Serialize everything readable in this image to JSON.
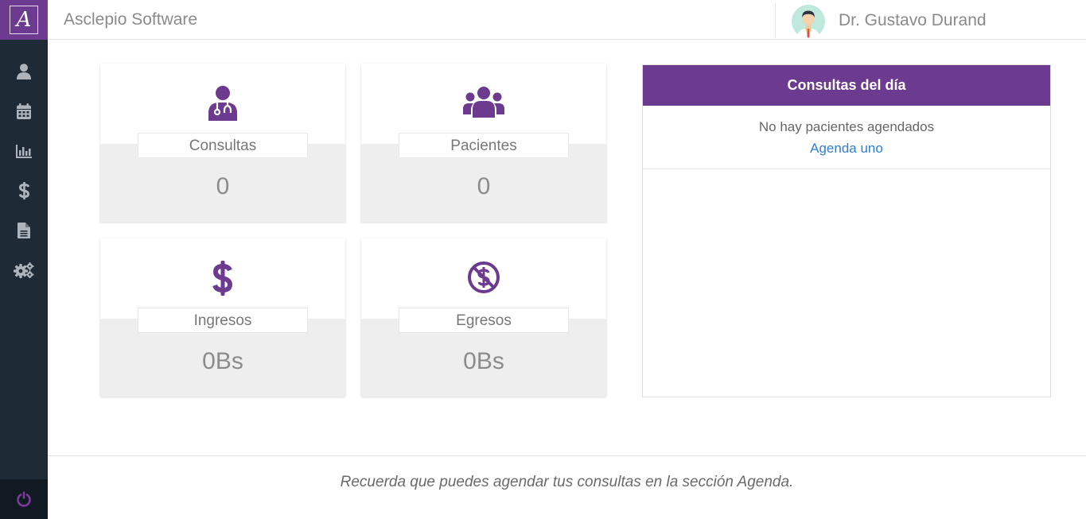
{
  "brand": {
    "logo_letter": "A",
    "app_title": "Asclepio Software",
    "accent": "#6c3a8e"
  },
  "user": {
    "name": "Dr. Gustavo Durand",
    "avatar_icon": "doctor-avatar-icon"
  },
  "sidebar": {
    "items": [
      {
        "icon": "user-icon"
      },
      {
        "icon": "calendar-icon"
      },
      {
        "icon": "bar-chart-icon"
      },
      {
        "icon": "dollar-icon"
      },
      {
        "icon": "document-icon"
      },
      {
        "icon": "settings-icon"
      }
    ],
    "logout_icon": "power-icon",
    "bg": "#1e2a35"
  },
  "cards": {
    "consultas": {
      "label": "Consultas",
      "value": "0",
      "icon": "doctor-icon"
    },
    "pacientes": {
      "label": "Pacientes",
      "value": "0",
      "icon": "users-icon"
    },
    "ingresos": {
      "label": "Ingresos",
      "value": "0Bs",
      "icon": "dollar-icon"
    },
    "egresos": {
      "label": "Egresos",
      "value": "0Bs",
      "icon": "no-dollar-icon"
    }
  },
  "day_panel": {
    "title": "Consultas del día",
    "empty_text": "No hay pacientes agendados",
    "link_text": "Agenda uno"
  },
  "footer": {
    "text": "Recuerda que puedes agendar tus consultas en la sección Agenda."
  }
}
